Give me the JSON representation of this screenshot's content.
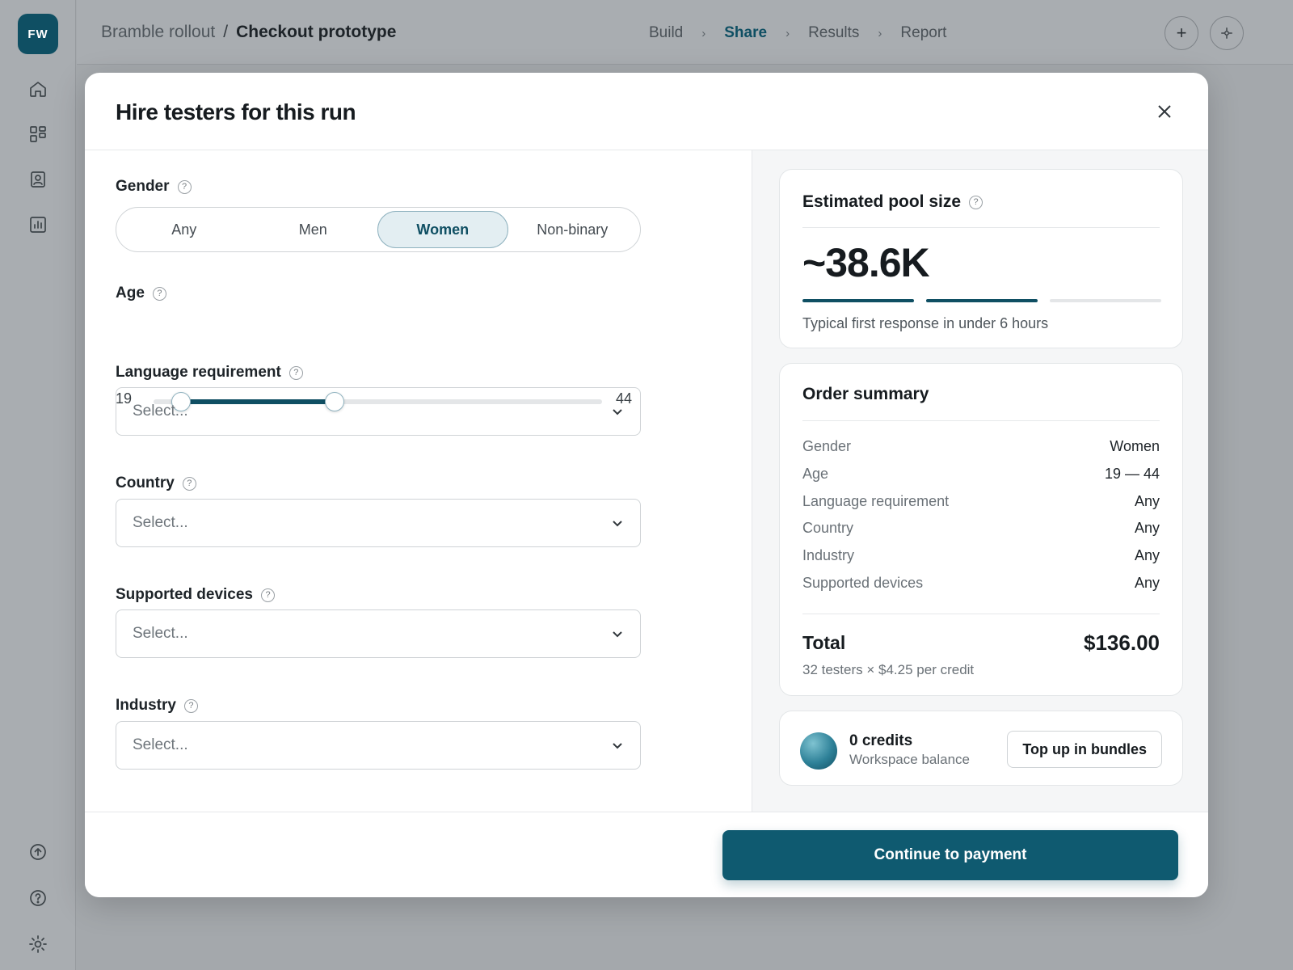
{
  "app": {
    "logo_text": "FW",
    "breadcrumb": {
      "project": "Bramble rollout",
      "separator": "/",
      "page": "Checkout prototype"
    },
    "steps": [
      "Build",
      "Share",
      "Results",
      "Report"
    ],
    "active_step": "Share",
    "sidebar_icons": [
      "home-icon",
      "grid-icon",
      "user-card-icon",
      "chart-icon",
      "upload-icon",
      "help-icon",
      "settings-sun-icon"
    ],
    "top_actions": [
      "plus-icon",
      "crosshair-icon"
    ]
  },
  "modal": {
    "title": "Hire testers for this run",
    "gender": {
      "label": "Gender",
      "options": [
        "Any",
        "Men",
        "Women",
        "Non-binary"
      ],
      "selected": "Women"
    },
    "age": {
      "label": "Age",
      "min": "19",
      "max": "44"
    },
    "language": {
      "label": "Language requirement",
      "placeholder": "Select..."
    },
    "country": {
      "label": "Country",
      "placeholder": "Select..."
    },
    "devices": {
      "label": "Supported devices",
      "placeholder": "Select..."
    },
    "industry": {
      "label": "Industry",
      "placeholder": "Select..."
    },
    "help_glyph": "?"
  },
  "pool": {
    "title": "Estimated pool size",
    "value": "~38.6K",
    "level_segments_filled": 2,
    "level_segments_total": 3,
    "note": "Typical first response in under 6 hours"
  },
  "summary": {
    "title": "Order summary",
    "rows": [
      {
        "key": "Gender",
        "value": "Women"
      },
      {
        "key": "Age",
        "value": "19 — 44"
      },
      {
        "key": "Language requirement",
        "value": "Any"
      },
      {
        "key": "Country",
        "value": "Any"
      },
      {
        "key": "Industry",
        "value": "Any"
      },
      {
        "key": "Supported devices",
        "value": "Any"
      }
    ],
    "total_label": "Total",
    "total_value": "$136.00",
    "total_note": "32 testers × $4.25 per credit"
  },
  "balance": {
    "credits": "0 credits",
    "label": "Workspace balance",
    "topup_label": "Top up in bundles"
  },
  "footer": {
    "cta_label": "Continue to payment"
  },
  "colors": {
    "accent": "#0f4f63",
    "button": "#0f5a70",
    "overlay": "#a4a8ac"
  }
}
